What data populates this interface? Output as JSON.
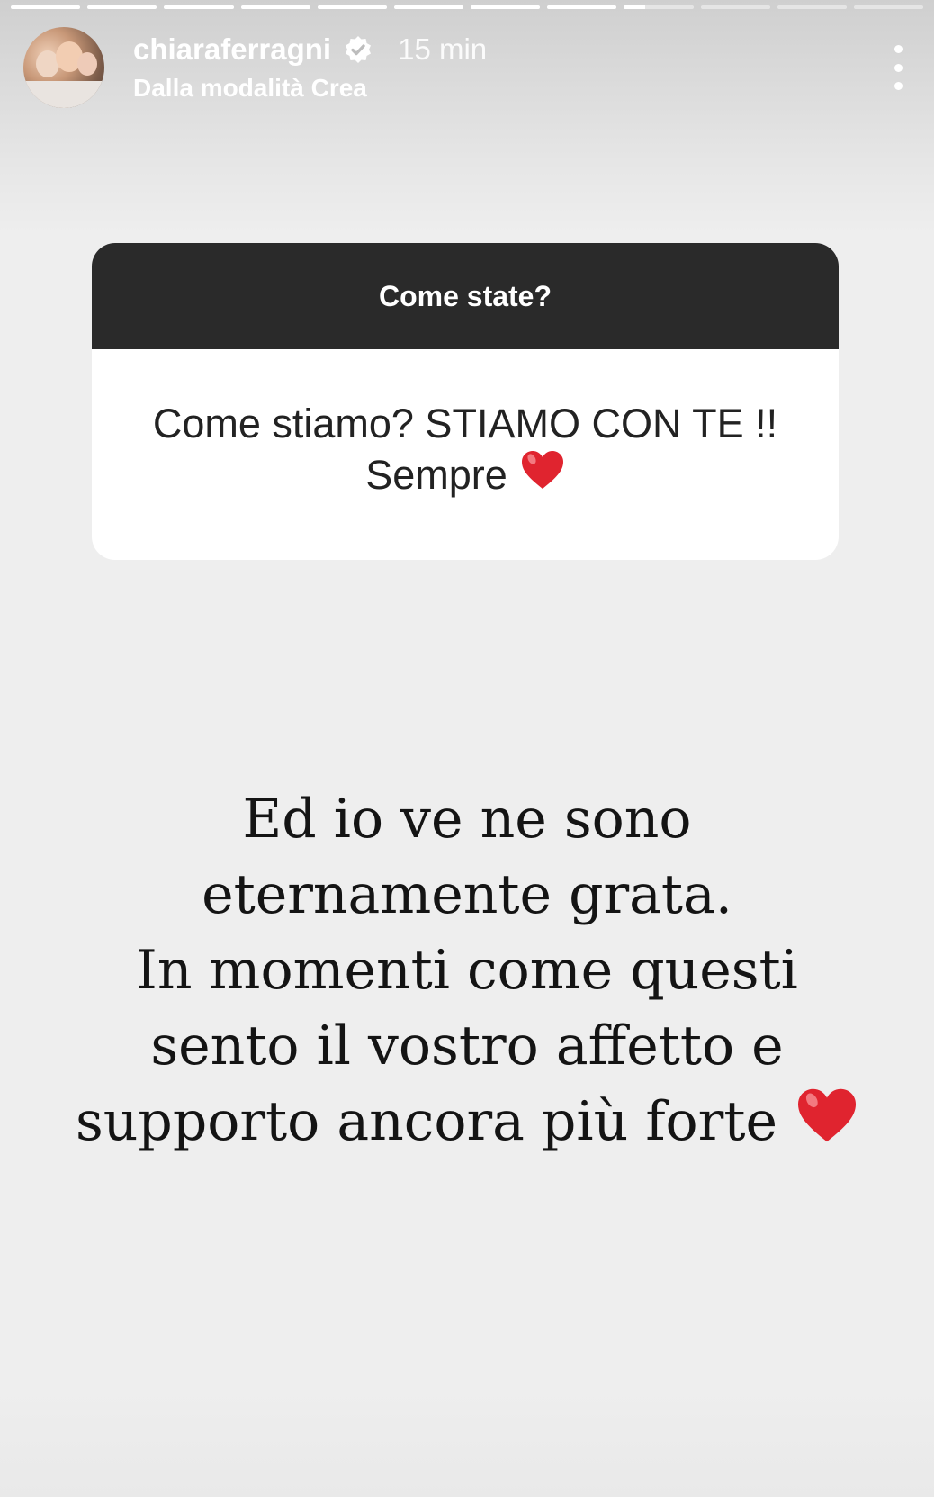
{
  "progress": {
    "segments": [
      1,
      1,
      1,
      1,
      1,
      1,
      1,
      1,
      0.3,
      0,
      0,
      0
    ]
  },
  "header": {
    "username": "chiaraferragni",
    "time": "15 min",
    "subtitle": "Dalla modalità Crea",
    "verified_icon": "verified-badge-icon",
    "more_icon": "more-vertical-icon"
  },
  "question_sticker": {
    "question": "Come state?",
    "answer_line1": "Come stiamo? STIAMO CON TE !!",
    "answer_line2": "Sempre",
    "answer_emoji": "red-heart-icon"
  },
  "story_text": {
    "lines": [
      "Ed io ve ne sono",
      "eternamente grata.",
      "In momenti come questi",
      "sento il vostro affetto e",
      "supporto ancora più forte"
    ],
    "trailing_emoji": "red-heart-icon"
  },
  "colors": {
    "heart": "#e0242f",
    "sticker_header": "#2a2a2a",
    "background": "#eeeeee"
  }
}
